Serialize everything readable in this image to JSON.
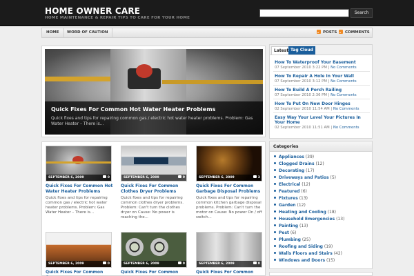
{
  "header": {
    "title": "HOME OWNER CARE",
    "tagline": "HOME MAINTENANCE & REPAIR TIPS TO CARE FOR YOUR HOME",
    "search_placeholder": "",
    "search_button": "Search"
  },
  "nav": {
    "items": [
      {
        "label": "HOME"
      },
      {
        "label": "WORD OF CAUTION"
      }
    ],
    "posts_label": "POSTS",
    "comments_label": "COMMENTS"
  },
  "featured": {
    "title": "Quick Fixes For Common Hot Water Heater Problems",
    "excerpt": "Quick fixes and tips for repairing common gas / electric hot water heater problems. Problem: Gas Water Heater – There is..."
  },
  "posts": [
    {
      "date": "SEPTEMBER 6, 2009",
      "comments": "0",
      "title": "Quick Fixes For Common Hot Water Heater Problems",
      "excerpt": "Quick fixes and tips for repairing common gas / electric hot water heater problems. Problem: Gas Water Heater – There is..."
    },
    {
      "date": "SEPTEMBER 6, 2009",
      "comments": "0",
      "title": "Quick Fixes For Common Clothes Dryer Problems",
      "excerpt": "Quick fixes and tips for repairing common clothes dryer problems. Problem: Can't turn the clothes dryer on Cause: No power is reaching the..."
    },
    {
      "date": "SEPTEMBER 6, 2009",
      "comments": "3",
      "title": "Quick Fixes For Common Garbage Disposal Problems",
      "excerpt": "Quick fixes and tips for repairing common kitchen garbage disposal problems. Problem: Can't turn the motor on Cause: No power On / off switch..."
    },
    {
      "date": "SEPTEMBER 6, 2009",
      "comments": "0",
      "title": "Quick Fixes For Common Oven",
      "excerpt": ""
    },
    {
      "date": "SEPTEMBER 6, 2009",
      "comments": "0",
      "title": "Quick Fixes For Common",
      "excerpt": ""
    },
    {
      "date": "SEPTEMBER 6, 2009",
      "comments": "0",
      "title": "Quick Fixes For Common",
      "excerpt": ""
    }
  ],
  "sidebar_tabs": {
    "tab_latest": "Latest",
    "tab_tags": "Tag Cloud",
    "latest": [
      {
        "title": "How To Waterproof Your Basement",
        "date": "07 September 2010 3:22 PM",
        "comments": "No Comments"
      },
      {
        "title": "How To Repair A Hole In Your Wall",
        "date": "07 September 2010 3:12 PM",
        "comments": "No Comments"
      },
      {
        "title": "How To Build A Porch Railing",
        "date": "07 September 2010 2:36 PM",
        "comments": "No Comments"
      },
      {
        "title": "How To Put On New Door Hinges",
        "date": "02 September 2010 11:54 AM",
        "comments": "No Comments"
      },
      {
        "title": "Easy Way Your Level Your Pictures In Your Home",
        "date": "02 September 2010 11:51 AM",
        "comments": "No Comments"
      }
    ]
  },
  "categories": {
    "heading": "Categories",
    "items": [
      {
        "name": "Appliances",
        "count": "(39)"
      },
      {
        "name": "Clogged Drains",
        "count": "(12)"
      },
      {
        "name": "Decorating",
        "count": "(17)"
      },
      {
        "name": "Driveways and Patios",
        "count": "(5)"
      },
      {
        "name": "Electrical",
        "count": "(12)"
      },
      {
        "name": "Featured",
        "count": "(6)"
      },
      {
        "name": "Fixtures",
        "count": "(13)"
      },
      {
        "name": "Garden",
        "count": "(12)"
      },
      {
        "name": "Heating and Cooling",
        "count": "(18)"
      },
      {
        "name": "Household Emergencies",
        "count": "(13)"
      },
      {
        "name": "Painting",
        "count": "(13)"
      },
      {
        "name": "Pest",
        "count": "(6)"
      },
      {
        "name": "Plumbing",
        "count": "(25)"
      },
      {
        "name": "Roofing and Siding",
        "count": "(19)"
      },
      {
        "name": "Walls Floors and Stairs",
        "count": "(42)"
      },
      {
        "name": "Windows and Doors",
        "count": "(15)"
      }
    ]
  },
  "colors": {
    "header_bg": "#1b1b1b",
    "link": "#1a5e9c",
    "tab_active": "#1a5e9c",
    "page_bg": "#eeeeee"
  }
}
